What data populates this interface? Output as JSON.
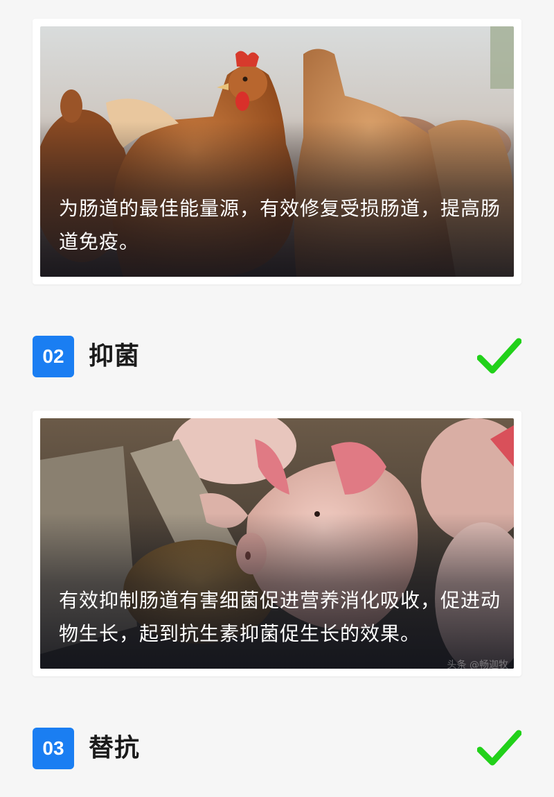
{
  "cards": [
    {
      "caption": "为肠道的最佳能量源，有效修复受损肠道，提高肠道免疫。",
      "image_subject": "hens"
    },
    {
      "caption": "有效抑制肠道有害细菌促进营养消化吸收，促进动物生长，起到抗生素抑菌促生长的效果。",
      "image_subject": "piglets",
      "watermark": "头条 @畅迦牧"
    }
  ],
  "sections": [
    {
      "number": "02",
      "title": "抑菌",
      "icon": "check-icon"
    },
    {
      "number": "03",
      "title": "替抗",
      "icon": "check-icon"
    }
  ],
  "colors": {
    "badge": "#1a7ef2",
    "check": "#22d11a",
    "background": "#f6f6f6"
  }
}
